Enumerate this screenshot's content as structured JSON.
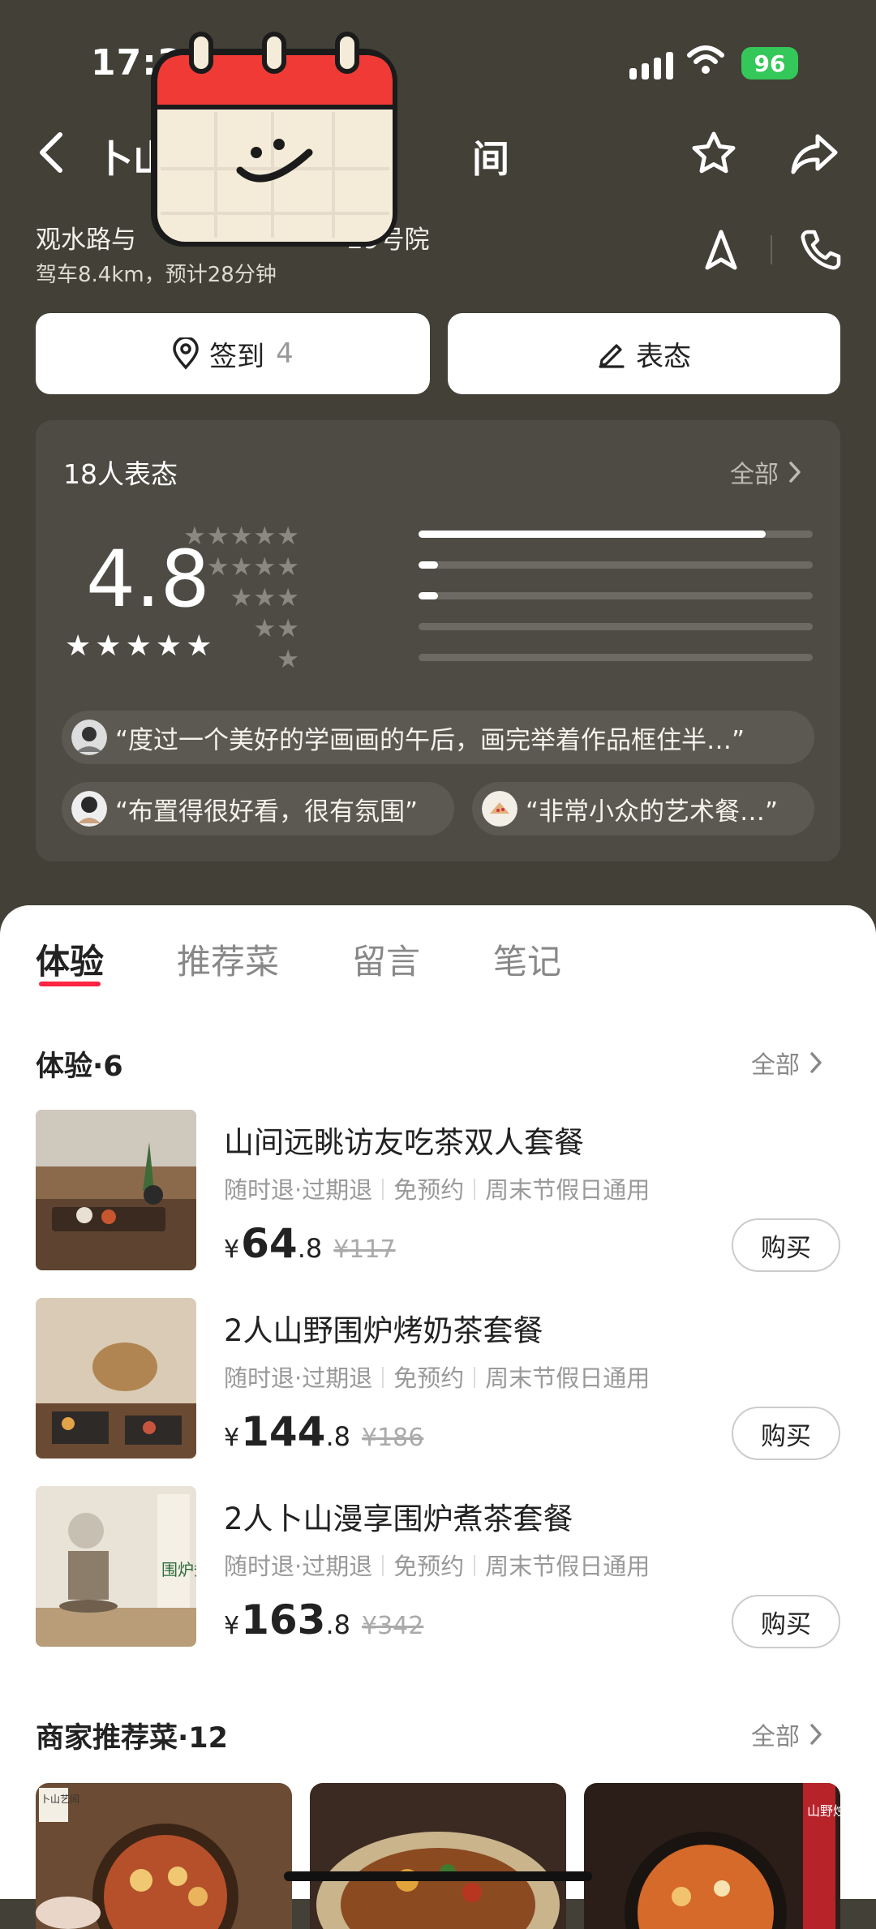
{
  "status_bar": {
    "time": "17:3",
    "battery": "96"
  },
  "header": {
    "title_visible_start": "卜山",
    "title_visible_end": "间",
    "address_start": "观水路与",
    "address_end": "29号院",
    "drive_info": "驾车8.4km，预计28分钟"
  },
  "actions": {
    "checkin_label": "签到",
    "checkin_count": "4",
    "review_label": "表态"
  },
  "rating": {
    "title": "18人表态",
    "all_label": "全部",
    "score": "4.8",
    "distribution": [
      {
        "stars": 5,
        "fraction": 0.88
      },
      {
        "stars": 4,
        "fraction": 0.05
      },
      {
        "stars": 3,
        "fraction": 0.05
      },
      {
        "stars": 2,
        "fraction": 0
      },
      {
        "stars": 1,
        "fraction": 0
      }
    ],
    "quotes": [
      "“度过一个美好的学画画的午后，画完举着作品框住半…”",
      "“布置得很好看，很有氛围”",
      "“非常小众的艺术餐…”"
    ]
  },
  "tabs": [
    "体验",
    "推荐菜",
    "留言",
    "笔记"
  ],
  "experience": {
    "title": "体验·6",
    "all_label": "全部",
    "tag_1": "随时退·过期退",
    "tag_2": "免预约",
    "tag_3": "周末节假日通用",
    "buy_label": "购买",
    "deals": [
      {
        "name": "山间远眺访友吃茶双人套餐",
        "yen": "¥",
        "price_int": "64",
        "price_dec": ".8",
        "orig": "¥117"
      },
      {
        "name": "2人山野围炉烤奶茶套餐",
        "yen": "¥",
        "price_int": "144",
        "price_dec": ".8",
        "orig": "¥186"
      },
      {
        "name": "2人卜山漫享围炉煮茶套餐",
        "yen": "¥",
        "price_int": "163",
        "price_dec": ".8",
        "orig": "¥342"
      }
    ]
  },
  "dishes": {
    "title": "商家推荐菜·12",
    "all_label": "全部",
    "photo_text_1": "卜山艺间",
    "photo_text_2": "山野烛光酸汤",
    "photo_text_3": "围炉煮茶"
  },
  "colors": {
    "accent": "#ff2442",
    "header_bg": "#424037",
    "battery": "#34c759"
  }
}
